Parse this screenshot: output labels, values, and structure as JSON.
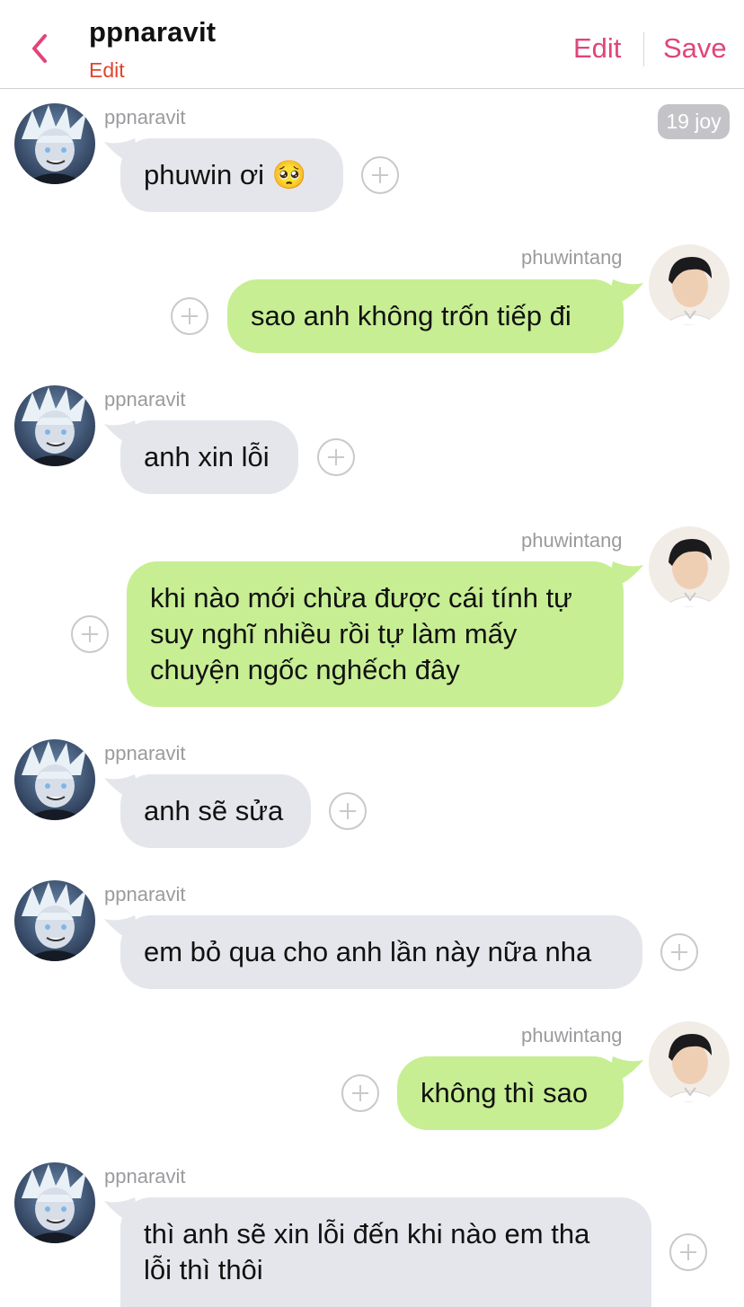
{
  "header": {
    "title": "ppnaravit",
    "subtitle": "Edit",
    "edit_label": "Edit",
    "save_label": "Save",
    "accent_color": "#e0457a",
    "subtitle_color": "#e0452f"
  },
  "date_badge": "19 joy",
  "messages": [
    {
      "side": "left",
      "sender": "ppnaravit",
      "text": "phuwin ơi 🥺"
    },
    {
      "side": "right",
      "sender": "phuwintang",
      "text": "sao anh không trốn tiếp đi"
    },
    {
      "side": "left",
      "sender": "ppnaravit",
      "text": "anh xin lỗi"
    },
    {
      "side": "right",
      "sender": "phuwintang",
      "lines": [
        "khi nào mới chừa được cái tính tự",
        "suy nghĩ nhiều rồi tự làm mấy",
        "chuyện ngốc nghếch đây"
      ]
    },
    {
      "side": "left",
      "sender": "ppnaravit",
      "text": "anh sẽ sửa"
    },
    {
      "side": "left",
      "sender": "ppnaravit",
      "text": "em bỏ qua cho anh lần này nữa nha"
    },
    {
      "side": "right",
      "sender": "phuwintang",
      "text": "không thì sao"
    },
    {
      "side": "left",
      "sender": "ppnaravit",
      "lines": [
        "thì anh sẽ xin lỗi đến khi nào em tha",
        "lỗi thì thôi"
      ]
    }
  ],
  "colors": {
    "left_bubble": "#e5e6eb",
    "right_bubble": "#c7ee93",
    "sender_name": "#9b9b9f"
  }
}
